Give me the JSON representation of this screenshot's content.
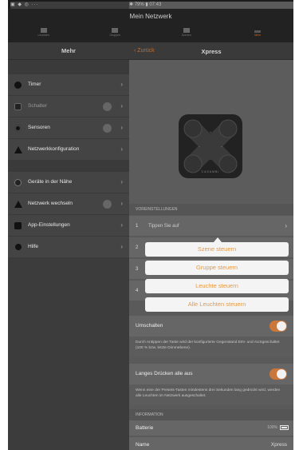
{
  "status": {
    "left": "▣ ◆ ◎ ···",
    "right": "✱ 79% ▮ 07:43"
  },
  "app": {
    "network_title": "Mein Netzwerk"
  },
  "tabs": [
    {
      "label": "Leuchten",
      "icon": "lamp-icon",
      "active": false
    },
    {
      "label": "Gruppen",
      "icon": "groups-icon",
      "active": false
    },
    {
      "label": "Szenen",
      "icon": "scenes-icon",
      "active": false
    },
    {
      "label": "Mehr",
      "icon": "more-icon",
      "active": true
    }
  ],
  "sidebar": {
    "title": "Mehr",
    "items": [
      {
        "label": "Timer",
        "icon": "clock-icon"
      },
      {
        "label": "Schalter",
        "icon": "switch-icon"
      },
      {
        "label": "Sensoren",
        "icon": "sensor-icon"
      },
      {
        "label": "Netzwerkkonfiguration",
        "icon": "network-config-icon"
      },
      {
        "label": "Geräte in der Nähe",
        "icon": "nearby-devices-icon"
      },
      {
        "label": "Netzwerk wechseln",
        "icon": "switch-network-icon"
      },
      {
        "label": "App-Einstellungen",
        "icon": "settings-icon"
      },
      {
        "label": "Hilfe",
        "icon": "help-icon"
      }
    ]
  },
  "detail": {
    "back_label": "Zurück",
    "title": "Xpress",
    "device_brand": "CASAMBI",
    "presets_header": "VOREINSTELLUNGEN",
    "rows": [
      {
        "num": "1",
        "hint": "Tippen Sie auf"
      },
      {
        "num": "2",
        "hint": ""
      },
      {
        "num": "3",
        "hint": ""
      },
      {
        "num": "4",
        "hint": ""
      }
    ],
    "popover": [
      "Szene steuern",
      "Gruppe steuern",
      "Leuchte steuern",
      "Alle Leuchten steuern"
    ],
    "umschalten": {
      "label": "Umschalten",
      "on": true,
      "desc": "Durch Antippen der Taste wird der konfigurierte Gegenstand EIN- und AUSgeschaltet (100 % bzw. letzte Dimmebene)."
    },
    "long_press": {
      "label": "Langes Drücken alle aus",
      "on": true,
      "desc": "Wenn eine der Presets-Tasten mindestens drei Sekunden lang gedrückt wird, werden alle Leuchten im Netzwerk ausgeschaltet."
    },
    "info_header": "INFORMATION",
    "battery_label": "Batterie",
    "battery_value": "100%",
    "name_label": "Name",
    "name_value": "Xpress"
  },
  "colors": {
    "accent": "#d2691e",
    "popover_text": "#e59a46",
    "toggle_on": "#c9773a"
  }
}
